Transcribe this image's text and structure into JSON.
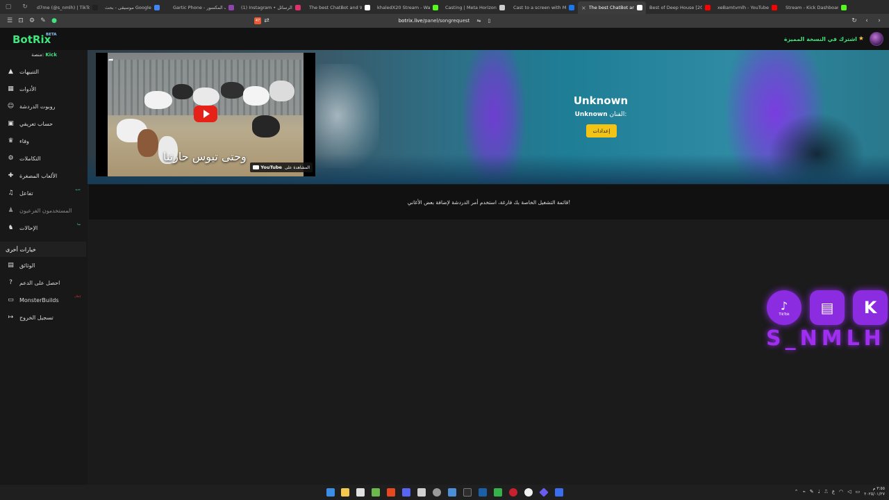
{
  "browser": {
    "tabs": [
      {
        "title": "d7me (@s_nmlh) | TikTok(5)",
        "color": "#222222"
      },
      {
        "title": "موسيقى - بحث Google",
        "color": "#4285f4"
      },
      {
        "title": "Gartic Phone - هاتف المكسور",
        "color": "#8e44ad"
      },
      {
        "title": "(1) Instagram • الرسائل",
        "color": "#e1306c"
      },
      {
        "title": "The best ChatBot and Widg",
        "color": "#ffffff"
      },
      {
        "title": "khaledX20 Stream - Watch",
        "color": "#53fc18"
      },
      {
        "title": "Casting | Meta Horizon",
        "color": "#cccccc"
      },
      {
        "title": "Cast to a screen with Meta",
        "color": "#1877f2"
      },
      {
        "title": "The best ChatBot and V",
        "color": "#ffffff",
        "active": true
      },
      {
        "title": "Best of Deep House [2025]",
        "color": "#ff0000"
      },
      {
        "title": "xeBamtvmlh - YouTube",
        "color": "#ff0000"
      },
      {
        "title": "Stream - Kick Dashboard",
        "color": "#53fc18"
      }
    ],
    "url_domain": "botrix.live",
    "url_path": "/panel/songrequest",
    "brave_badge": "47"
  },
  "navbar": {
    "logo": "BotRix",
    "beta": "BETA",
    "premium": "اشترك في النسخة المميزة"
  },
  "sidebar": {
    "platform_label": "منصة:",
    "platform_value": "Kick",
    "items": [
      {
        "label": "التنبيهات",
        "icon": "alert-triangle-icon",
        "glyph": "▲"
      },
      {
        "label": "الأدوات",
        "icon": "widgets-icon",
        "glyph": "▦"
      },
      {
        "label": "روبوت الدردشة",
        "icon": "robot-icon",
        "glyph": "☺"
      },
      {
        "label": "حساب تعريفي",
        "icon": "profile-card-icon",
        "glyph": "▣"
      },
      {
        "label": "وفاء",
        "icon": "trophy-icon",
        "glyph": "♛"
      },
      {
        "label": "التكاملات",
        "icon": "integrations-icon",
        "glyph": "⚙"
      },
      {
        "label": "الألعاب المصغرة",
        "icon": "gamepad-icon",
        "glyph": "✚"
      },
      {
        "label": "تفاعل",
        "icon": "music-note-icon",
        "glyph": "♫",
        "badge": "جديد"
      },
      {
        "label": "المستخدمون الفرعيون",
        "icon": "sub-users-icon",
        "glyph": "♟",
        "dim": true
      },
      {
        "label": "الإحالات",
        "icon": "users-icon",
        "glyph": "♞",
        "badge": "بيتا"
      }
    ],
    "other_header": "خيارات أخرى",
    "other_items": [
      {
        "label": "الوثائق",
        "icon": "docs-icon",
        "glyph": "▤"
      },
      {
        "label": "احصل على الدعم",
        "icon": "help-icon",
        "glyph": "?"
      },
      {
        "label": "MonsterBuilds",
        "icon": "laptop-icon",
        "glyph": "▭",
        "badge": "إعلان"
      },
      {
        "label": "تسجيل الخروج",
        "icon": "logout-icon",
        "glyph": "↦"
      }
    ]
  },
  "player": {
    "caption": "وحتى تيوس حارتنا",
    "watch_on": "المشاهدة على",
    "youtube": "YouTube"
  },
  "song": {
    "title": "Unknown",
    "artist_label": "الفنان:",
    "artist": "Unknown",
    "settings_button": "إعدادات"
  },
  "playlist_empty": "قائمة التشغيل الخاصة بك فارغة، استخدم أمر الدردشة لإضافة بعض الأغاني!",
  "overlay": {
    "tiktok_label": "TikTok",
    "nickname": "S_NMLH"
  },
  "taskbar": {
    "time": "٣:٥٥ م",
    "date": "٢٠٢٥/٠١/٢٧",
    "lang": "ع"
  },
  "colors": {
    "accent": "#3fe67e",
    "settings": "#f3c316",
    "overlay": "#8c2ce0"
  }
}
